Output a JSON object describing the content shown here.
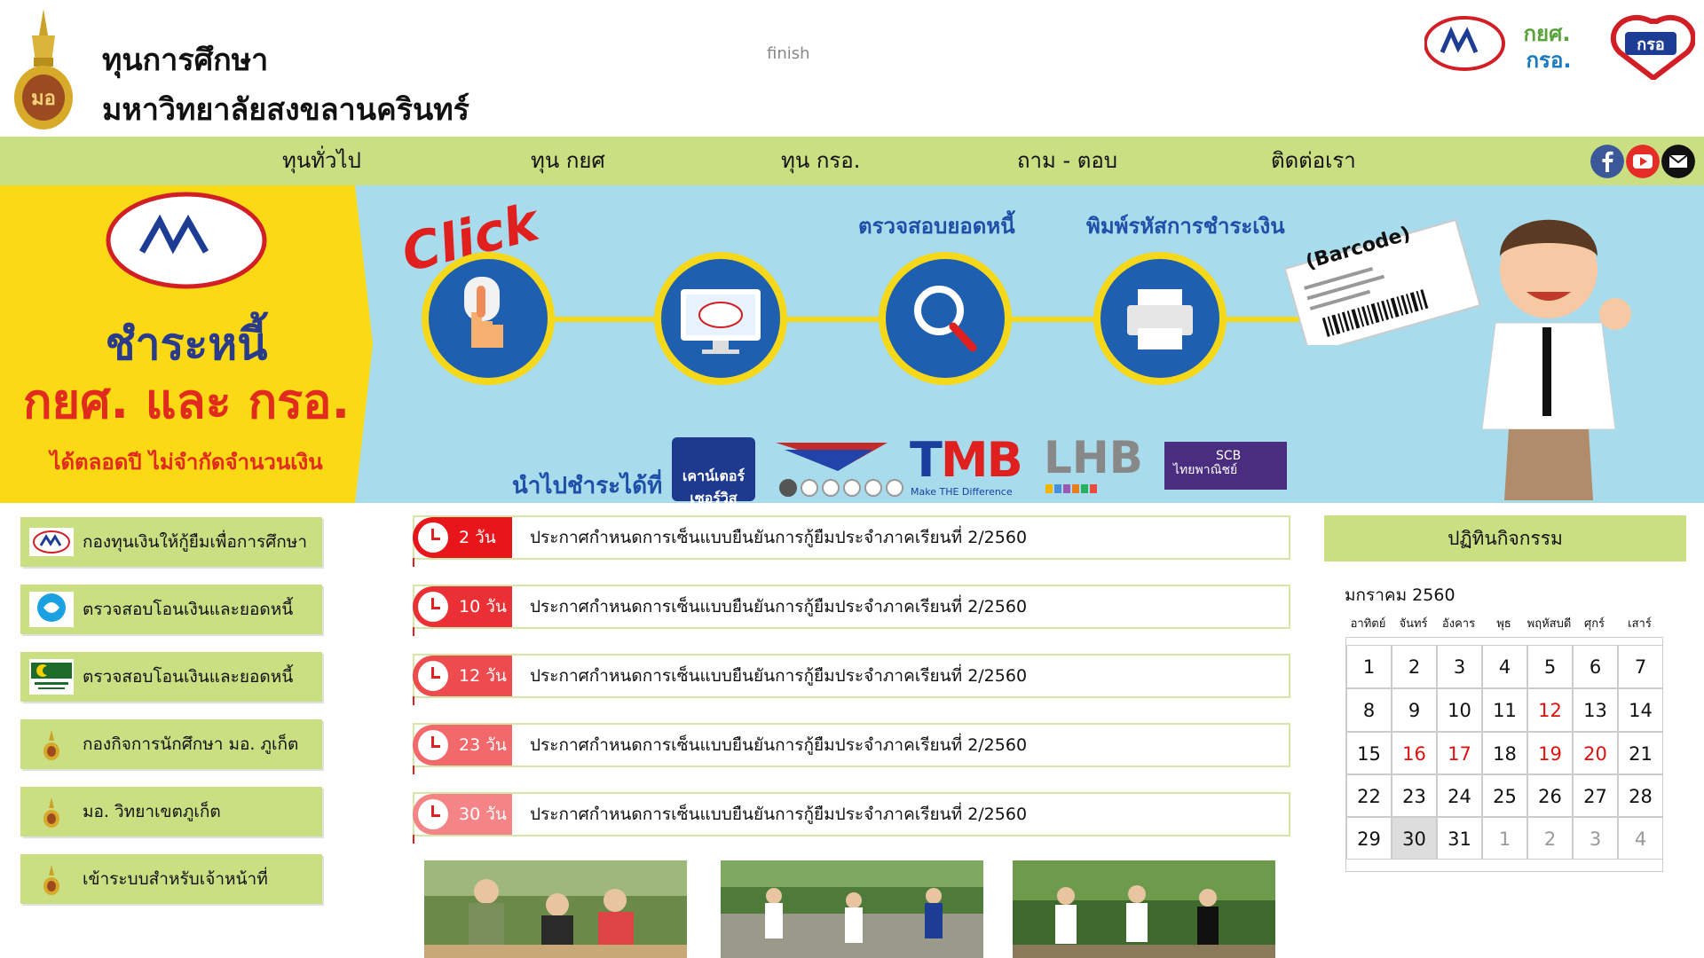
{
  "header": {
    "title_line1": "ทุนการศึกษา",
    "title_line2": "มหาวิทยาลัยสงขลานครินทร์",
    "center_text": "finish",
    "right_logo_text1": "กยศ.",
    "right_logo_text2": "กรอ.",
    "right_logo_text3": "กรอ"
  },
  "nav": {
    "items": [
      "ทุนทั่วไป",
      "ทุน กยศ",
      "ทุน กรอ.",
      "ถาม - ตอบ",
      "ติดต่อเรา"
    ],
    "social_icons": [
      "facebook-icon",
      "youtube-icon",
      "mail-icon"
    ]
  },
  "banner": {
    "word1": "ชำระหนี้",
    "word2": "กยศ. และ กรอ.",
    "word3": "ได้ตลอดปี ไม่จำกัดจำนวนเงิน",
    "click": "Click",
    "caption_check": "ตรวจสอบยอดหนี้",
    "caption_print": "พิมพ์รหัสการชำระเงิน",
    "barcode": "(Barcode)",
    "pay_at": "นำไปชำระได้ที่",
    "counter": "เคาน์เตอร์เซอร์วิส",
    "tmb_t": "T",
    "tmb_mb": "MB",
    "tmb_sub": "Make THE Difference",
    "lhb": "LHB",
    "scb1": "SCB",
    "scb2": "ไทยพาณิชย์",
    "dots_count": 6,
    "active_dot": 0
  },
  "sidebar": {
    "items": [
      {
        "label": "กองทุนเงินให้กู้ยืมเพื่อการศึกษา",
        "icon": "kyc-logo-icon"
      },
      {
        "label": "ตรวจสอบโอนเงินและยอดหนี้",
        "icon": "krungthai-logo-icon"
      },
      {
        "label": "ตรวจสอบโอนเงินและยอดหนี้",
        "icon": "islamic-bank-logo-icon"
      },
      {
        "label": "กองกิจการนักศึกษา มอ. ภูเก็ต",
        "icon": "psu-emblem-icon"
      },
      {
        "label": "มอ. วิทยาเขตภูเก็ต",
        "icon": "psu-emblem-icon"
      },
      {
        "label": "เข้าระบบสำหรับเจ้าหน้าที่",
        "icon": "psu-emblem-icon"
      }
    ]
  },
  "news": {
    "items": [
      {
        "days": "2 วัน",
        "text": "ประกาศกำหนดการเซ็นแบบยืนยันการกู้ยืมประจำภาคเรียนที่ 2/2560",
        "color": "#e8151b"
      },
      {
        "days": "10 วัน",
        "text": "ประกาศกำหนดการเซ็นแบบยืนยันการกู้ยืมประจำภาคเรียนที่ 2/2560",
        "color": "#ea3034"
      },
      {
        "days": "12 วัน",
        "text": "ประกาศกำหนดการเซ็นแบบยืนยันการกู้ยืมประจำภาคเรียนที่ 2/2560",
        "color": "#ee4b4f"
      },
      {
        "days": "23 วัน",
        "text": "ประกาศกำหนดการเซ็นแบบยืนยันการกู้ยืมประจำภาคเรียนที่ 2/2560",
        "color": "#f2686b"
      },
      {
        "days": "30 วัน",
        "text": "ประกาศกำหนดการเซ็นแบบยืนยันการกู้ยืมประจำภาคเรียนที่ 2/2560",
        "color": "#f48486"
      }
    ]
  },
  "calendar": {
    "header": "ปฏิทินกิจกรรม",
    "month": "มกราคม 2560",
    "days_of_week": [
      "อาทิตย์",
      "จันทร์",
      "อังคาร",
      "พุธ",
      "พฤหัสบดี",
      "ศุกร์",
      "เสาร์"
    ],
    "weeks": [
      [
        {
          "d": "1"
        },
        {
          "d": "2"
        },
        {
          "d": "3"
        },
        {
          "d": "4"
        },
        {
          "d": "5"
        },
        {
          "d": "6"
        },
        {
          "d": "7"
        }
      ],
      [
        {
          "d": "8"
        },
        {
          "d": "9"
        },
        {
          "d": "10"
        },
        {
          "d": "11"
        },
        {
          "d": "12",
          "red": true
        },
        {
          "d": "13"
        },
        {
          "d": "14"
        }
      ],
      [
        {
          "d": "15"
        },
        {
          "d": "16",
          "red": true
        },
        {
          "d": "17",
          "red": true
        },
        {
          "d": "18"
        },
        {
          "d": "19",
          "red": true
        },
        {
          "d": "20",
          "red": true
        },
        {
          "d": "21"
        }
      ],
      [
        {
          "d": "22"
        },
        {
          "d": "23"
        },
        {
          "d": "24"
        },
        {
          "d": "25"
        },
        {
          "d": "26"
        },
        {
          "d": "27"
        },
        {
          "d": "28"
        }
      ],
      [
        {
          "d": "29"
        },
        {
          "d": "30",
          "today": true
        },
        {
          "d": "31"
        },
        {
          "d": "1",
          "other": true
        },
        {
          "d": "2",
          "other": true
        },
        {
          "d": "3",
          "other": true
        },
        {
          "d": "4",
          "other": true
        }
      ]
    ]
  },
  "colors": {
    "accent_green": "#c9df82",
    "banner_blue": "#a8dcec",
    "banner_yellow": "#fbd914",
    "red": "#e8151b"
  }
}
